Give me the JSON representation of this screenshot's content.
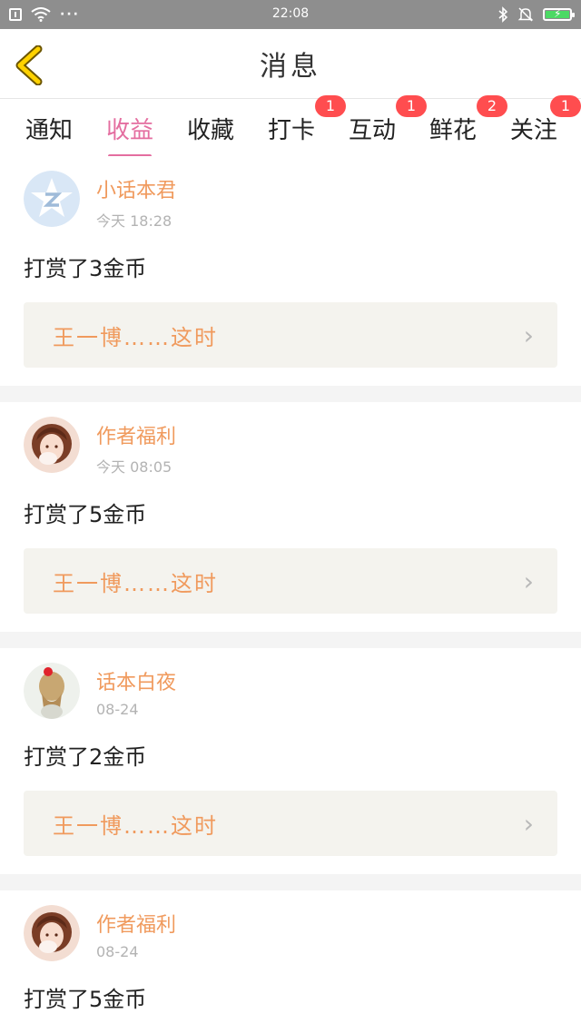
{
  "status_bar": {
    "time": "22:08",
    "icons": [
      "sim-icon",
      "wifi-icon",
      "more-icon",
      "bluetooth-icon",
      "bell-off-icon",
      "battery-charging-icon"
    ]
  },
  "header": {
    "title": "消息",
    "back_icon": "chevron-left-icon"
  },
  "tabs": [
    {
      "label": "通知",
      "badge": ""
    },
    {
      "label": "收益",
      "badge": "",
      "active": true
    },
    {
      "label": "收藏",
      "badge": ""
    },
    {
      "label": "打卡",
      "badge": "1"
    },
    {
      "label": "互动",
      "badge": "1"
    },
    {
      "label": "鲜花",
      "badge": "2"
    },
    {
      "label": "关注",
      "badge": "1"
    }
  ],
  "messages": [
    {
      "user": "小话本君",
      "time": "今天 18:28",
      "action": "打赏了3金币",
      "ref": "王一博……这时",
      "avatar": "logo-avatar"
    },
    {
      "user": "作者福利",
      "time": "今天 08:05",
      "action": "打赏了5金币",
      "ref": "王一博……这时",
      "avatar": "girl-avatar"
    },
    {
      "user": "话本白夜",
      "time": "08-24",
      "action": "打赏了2金币",
      "ref": "王一博……这时",
      "avatar": "braid-avatar"
    },
    {
      "user": "作者福利",
      "time": "08-24",
      "action": "打赏了5金币",
      "ref": "",
      "avatar": "girl-avatar"
    }
  ],
  "colors": {
    "accent_pink": "#e46ea0",
    "accent_orange": "#f09a5d",
    "badge_red": "#ff4d4f",
    "status_bar": "#8e8e8e"
  }
}
